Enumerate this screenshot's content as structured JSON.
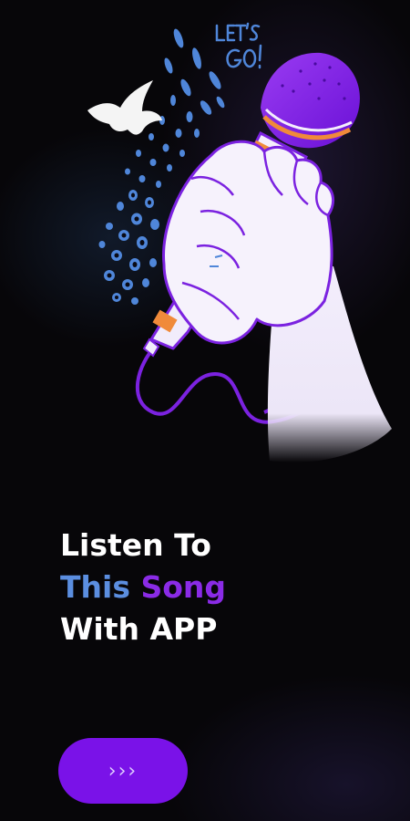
{
  "headline": {
    "line1": "Listen To",
    "line2_part1": "This",
    "line2_part2": "Song",
    "line3": "With APP"
  },
  "illustration": {
    "caption": "LET'S GO!"
  },
  "next_button": {
    "label": "›››"
  },
  "colors": {
    "background": "#070609",
    "accent_purple": "#7a12e8",
    "text_blue": "#5b8ee0",
    "text_purple": "#8a2be6",
    "text_white": "#ffffff"
  },
  "icons": [
    "microphone-hand-illustration",
    "bird-icon",
    "chevron-triple-right-icon"
  ]
}
